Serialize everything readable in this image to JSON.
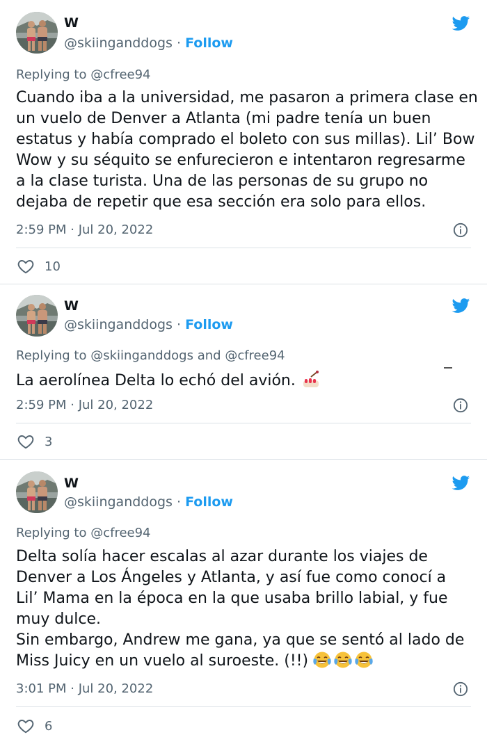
{
  "colors": {
    "link": "#1d9bf0",
    "secondary": "#536471",
    "text": "#0f1419",
    "border": "#dbe1e6"
  },
  "tweets": [
    {
      "author": {
        "name": "W",
        "handle": "@skiinganddogs",
        "separator": "·",
        "follow_label": "Follow",
        "avatar": "avatar-photo"
      },
      "reply": {
        "label": "Replying to",
        "mentions": [
          "@cfree94"
        ]
      },
      "text_lines": [
        "Cuando iba a la universidad, me pasaron a primera clase en",
        "un vuelo de Denver a Atlanta (mi padre tenía un buen",
        "estatus y había comprado el boleto con sus millas). Lil’ Bow",
        "Wow y su séquito se enfurecieron e intentaron regresarme",
        "a la clase turista. Una de las personas de su grupo no",
        "dejaba de repetir que esa sección era solo para ellos."
      ],
      "timestamp": "2:59 PM · Jul 20, 2022",
      "likes": "10"
    },
    {
      "author": {
        "name": "W",
        "handle": "@skiinganddogs",
        "separator": "·",
        "follow_label": "Follow",
        "avatar": "avatar-photo"
      },
      "reply": {
        "label": "Replying to",
        "mentions": [
          "@skiinganddogs",
          "@cfree94"
        ],
        "joiner": "and"
      },
      "text_lines": [
        "La aerolínea Delta lo echó del avión."
      ],
      "emoji": "nail-polish-emoji",
      "timestamp": "2:59 PM · Jul 20, 2022",
      "likes": "3"
    },
    {
      "author": {
        "name": "W",
        "handle": "@skiinganddogs",
        "separator": "·",
        "follow_label": "Follow",
        "avatar": "avatar-photo"
      },
      "reply": {
        "label": "Replying to",
        "mentions": [
          "@cfree94"
        ]
      },
      "text_lines": [
        "Delta solía hacer escalas al azar durante los viajes de",
        "Denver a Los Ángeles y Atlanta, y así fue como conocí a",
        "Lil’ Mama en la época en la que usaba brillo labial, y fue",
        "muy dulce.",
        "Sin embargo, Andrew me gana, ya que se sentó al lado de",
        "Miss Juicy en un vuelo al suroeste. (!!)"
      ],
      "emoji": "tears-of-joy-emoji",
      "emoji_count": 3,
      "timestamp": "3:01 PM · Jul 20, 2022",
      "likes": "6"
    }
  ]
}
